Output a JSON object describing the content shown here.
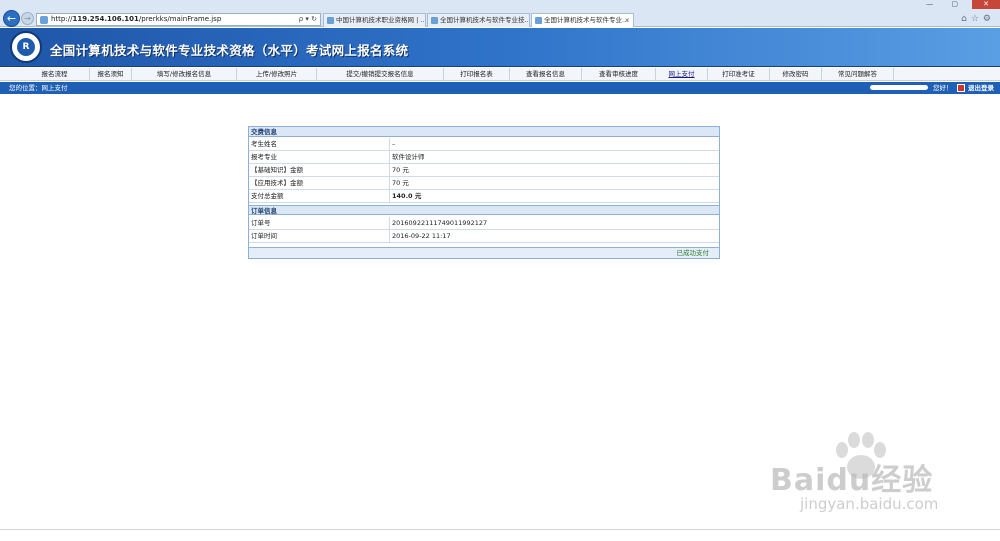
{
  "browser": {
    "url_prefix": "http://",
    "url_host": "119.254.106.101",
    "url_path": "/prerkks/mainFrame.jsp",
    "addr_tools": "ρ ▾ ↻",
    "tabs": [
      {
        "label": "中国计算机技术职业资格网 | ..."
      },
      {
        "label": "全国计算机技术与软件专业技..."
      },
      {
        "label": "全国计算机技术与软件专业...",
        "close": "×"
      }
    ],
    "window_controls": "— ▢",
    "close_label": "✕",
    "toolbar_icons": "⌂☆⚙"
  },
  "banner": {
    "logo_text": "R",
    "title": "全国计算机技术与软件专业技术资格（水平）考试网上报名系统"
  },
  "nav": {
    "items": [
      {
        "label": "报名流程"
      },
      {
        "label": "报名须知"
      },
      {
        "label": "填写/修改报名信息"
      },
      {
        "label": "上传/修改照片"
      },
      {
        "label": "提交/撤销提交报名信息"
      },
      {
        "label": "打印报名表"
      },
      {
        "label": "查看报名信息"
      },
      {
        "label": "查看审核进度"
      },
      {
        "label": "网上支付"
      },
      {
        "label": "打印准考证"
      },
      {
        "label": "修改密码"
      },
      {
        "label": "常见问题解答"
      }
    ]
  },
  "location": {
    "text": "您的位置：网上支付",
    "greeting": "您好！",
    "logout": "退出登录"
  },
  "payment": {
    "section1_title": "交费信息",
    "rows1": [
      {
        "label": "考生姓名",
        "value": "–"
      },
      {
        "label": "报考专业",
        "value": "软件设计师"
      },
      {
        "label": "【基础知识】金额",
        "value": "70 元"
      },
      {
        "label": "【应用技术】金额",
        "value": "70 元"
      },
      {
        "label": "支付总金额",
        "value": "140.0 元"
      }
    ],
    "section2_title": "订单信息",
    "rows2": [
      {
        "label": "订单号",
        "value": "20160922111749011992127"
      },
      {
        "label": "订单时间",
        "value": "2016-09-22 11:17"
      }
    ],
    "status": "已成功支付"
  },
  "watermark": {
    "main": "Baidu经验",
    "sub": "jingyan.baidu.com"
  }
}
